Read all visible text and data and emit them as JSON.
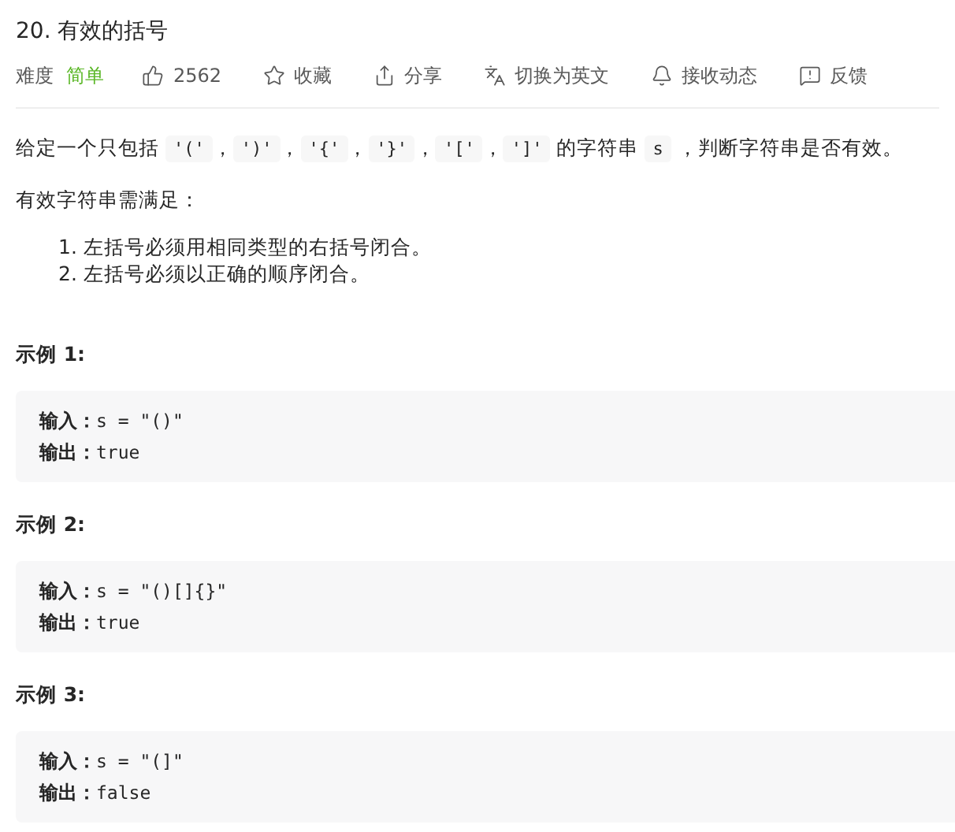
{
  "title": "20. 有效的括号",
  "meta": {
    "difficulty_label": "难度",
    "difficulty": "简单",
    "actions": [
      {
        "kind": "like",
        "label": "2562"
      },
      {
        "kind": "star",
        "label": "收藏"
      },
      {
        "kind": "share",
        "label": "分享"
      },
      {
        "kind": "translate",
        "label": "切换为英文"
      },
      {
        "kind": "bell",
        "label": "接收动态"
      },
      {
        "kind": "feedback",
        "label": "反馈"
      }
    ]
  },
  "description": [
    {
      "kind": "text",
      "text": "给定一个只包括 "
    },
    {
      "kind": "code",
      "text": "'('"
    },
    {
      "kind": "text",
      "text": "，"
    },
    {
      "kind": "code",
      "text": "')'"
    },
    {
      "kind": "text",
      "text": "，"
    },
    {
      "kind": "code",
      "text": "'{'"
    },
    {
      "kind": "text",
      "text": "，"
    },
    {
      "kind": "code",
      "text": "'}'"
    },
    {
      "kind": "text",
      "text": "，"
    },
    {
      "kind": "code",
      "text": "'['"
    },
    {
      "kind": "text",
      "text": "，"
    },
    {
      "kind": "code",
      "text": "']'"
    },
    {
      "kind": "text",
      "text": " 的字符串 "
    },
    {
      "kind": "code",
      "text": "s"
    },
    {
      "kind": "text",
      "text": " ，判断字符串是否有效。"
    }
  ],
  "requirements_intro": "有效字符串需满足：",
  "requirements": [
    "1. 左括号必须用相同类型的右括号闭合。",
    "2. 左括号必须以正确的顺序闭合。"
  ],
  "examples": [
    {
      "heading": "示例 1:",
      "lines": [
        {
          "label": "输入：",
          "value": "s = \"()\""
        },
        {
          "label": "输出：",
          "value": "true"
        }
      ]
    },
    {
      "heading": "示例 2:",
      "lines": [
        {
          "label": "输入：",
          "value": "s = \"()[]{}\""
        },
        {
          "label": "输出：",
          "value": "true"
        }
      ]
    },
    {
      "heading": "示例 3:",
      "lines": [
        {
          "label": "输入：",
          "value": "s = \"(]\""
        },
        {
          "label": "输出：",
          "value": "false"
        }
      ]
    }
  ]
}
